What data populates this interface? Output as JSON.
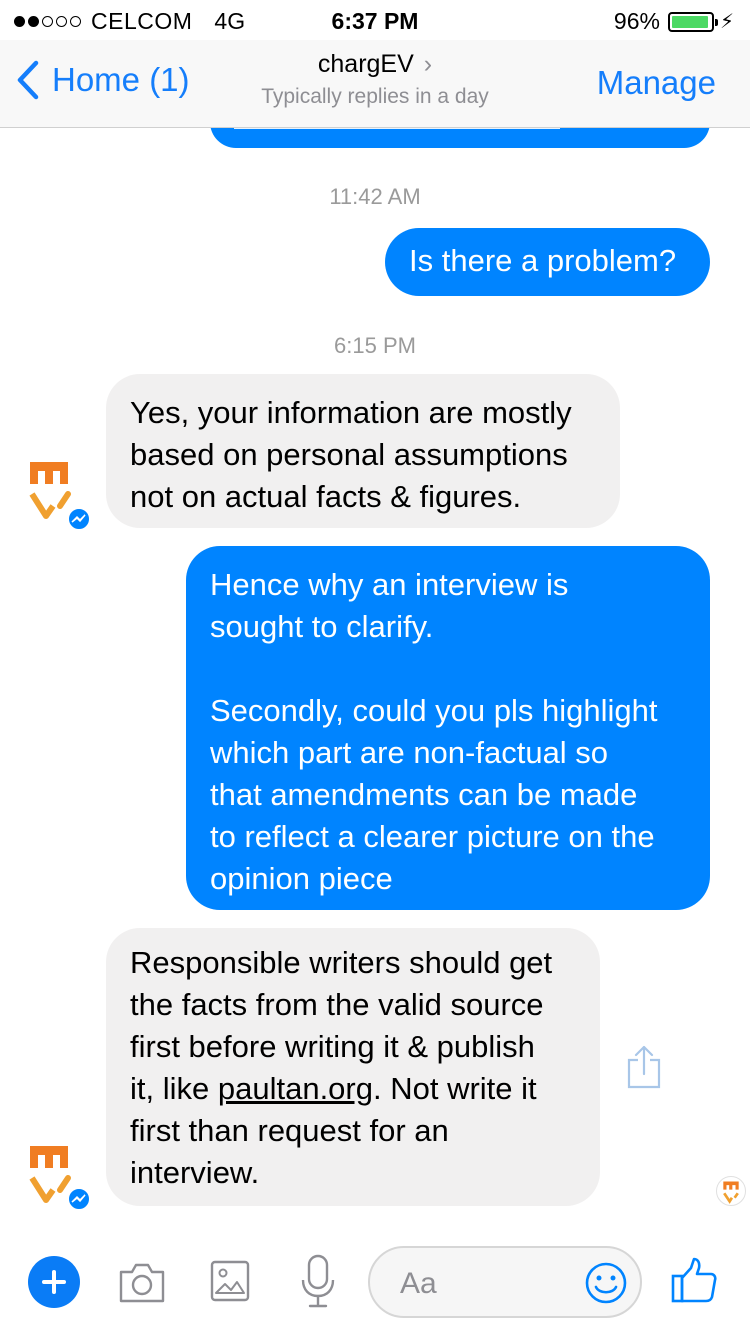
{
  "status_bar": {
    "carrier": "CELCOM",
    "network": "4G",
    "time": "6:37 PM",
    "battery": "96%"
  },
  "nav": {
    "back_label": "Home (1)",
    "title": "chargEV",
    "subtitle": "Typically replies in a day",
    "manage_label": "Manage"
  },
  "messages": {
    "ts1": "11:42 AM",
    "m1": "Is there a problem?",
    "ts2": "6:15 PM",
    "m2": "Yes, your information are mostly\nbased on personal assumptions\nnot on actual facts & figures.",
    "m3_p1": "Hence why an interview is\nsought to clarify.",
    "m3_p2": "Secondly, could you pls highlight\nwhich part are non-factual so\nthat amendments can be made\nto reflect a clearer picture on the\nopinion piece",
    "m4_pre": "Responsible writers should get\nthe facts from the valid source\nfirst before writing it & publish\nit, like ",
    "m4_link": "paultan.org",
    "m4_post": ". Not write it\nfirst than request for an\ninterview."
  },
  "composer": {
    "placeholder": "Aa"
  },
  "colors": {
    "accent": "#0084ff",
    "incoming_bubble": "#f1f0f0",
    "brand_orange": "#f07d22"
  }
}
